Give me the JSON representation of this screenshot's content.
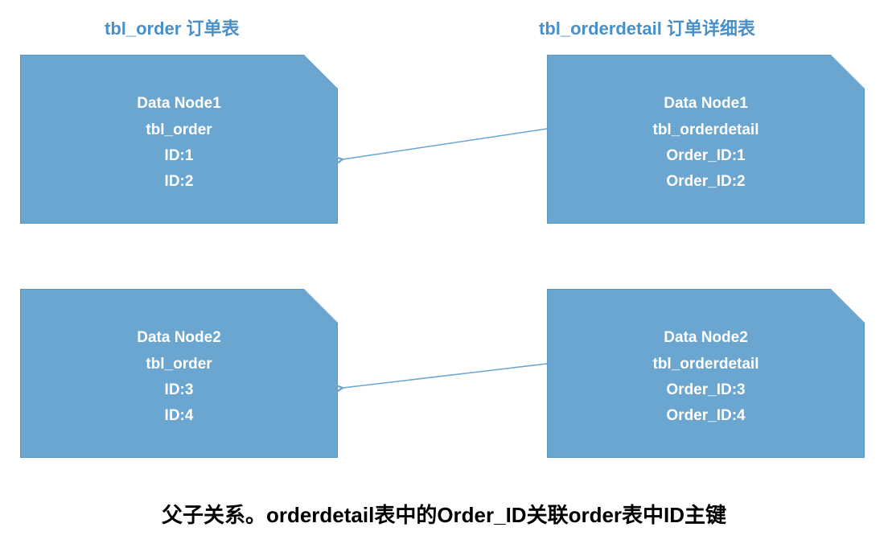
{
  "headings": {
    "left": "tbl_order 订单表",
    "right": "tbl_orderdetail 订单详细表"
  },
  "nodes": {
    "topLeft": {
      "title": "Data Node1",
      "table": "tbl_order",
      "row1": "ID:1",
      "row2": "ID:2"
    },
    "topRight": {
      "title": "Data Node1",
      "table": "tbl_orderdetail",
      "row1": "Order_ID:1",
      "row2": "Order_ID:2"
    },
    "bottomLeft": {
      "title": "Data Node2",
      "table": "tbl_order",
      "row1": "ID:3",
      "row2": "ID:4"
    },
    "bottomRight": {
      "title": "Data Node2",
      "table": "tbl_orderdetail",
      "row1": "Order_ID:3",
      "row2": "Order_ID:4"
    }
  },
  "footer": "父子关系。orderdetail表中的Order_ID关联order表中ID主键",
  "colors": {
    "headingColor": "#4a8fc7",
    "nodeFill": "#6aa6d0",
    "arrowColor": "#6aa6d0"
  }
}
